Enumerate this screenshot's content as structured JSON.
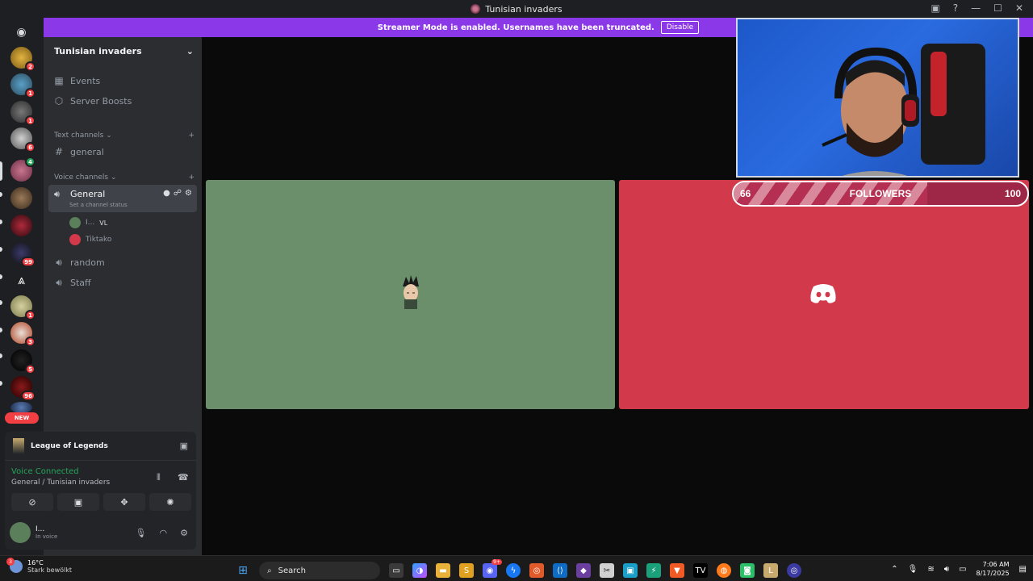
{
  "window": {
    "title": "Tunisian invaders"
  },
  "banner": {
    "text": "Streamer Mode is enabled. Usernames have been truncated.",
    "disable_label": "Disable"
  },
  "rail": {
    "badges": [
      "2",
      "1",
      "1",
      "6",
      "4",
      "99",
      "1",
      "3",
      "5",
      "96"
    ],
    "new_label": "NEW"
  },
  "sidebar": {
    "server_name": "Tunisian invaders",
    "events": "Events",
    "boosts": "Server Boosts",
    "text_category": "Text channels",
    "text_channel": "general",
    "voice_category": "Voice channels",
    "voice_general": "General",
    "channel_status": "Set a channel status",
    "voice_user1": "I...",
    "voice_user1_tag": "VL",
    "voice_user2": "Tiktako",
    "voice_random": "random",
    "voice_staff": "Staff"
  },
  "panel": {
    "game": "League of Legends",
    "voice_connected": "Voice Connected",
    "voice_location": "General / Tunisian invaders",
    "user_name": "I...",
    "user_status": "In voice"
  },
  "overlay": {
    "followers_label": "FOLLOWERS",
    "followers_current": "66",
    "followers_goal": "100",
    "followers_progress": 0.66
  },
  "taskbar": {
    "weather_temp": "16°C",
    "weather_desc": "Stark bewölkt",
    "weather_badge": "3",
    "search_label": "Search",
    "time": "7:06 AM",
    "date": "8/17/2025",
    "messenger_badge": "9+"
  },
  "colors": {
    "banner": "#8b38e8",
    "tile_green": "#6b8f6b",
    "tile_red": "#d23a4b",
    "voice_green": "#23a55a"
  }
}
